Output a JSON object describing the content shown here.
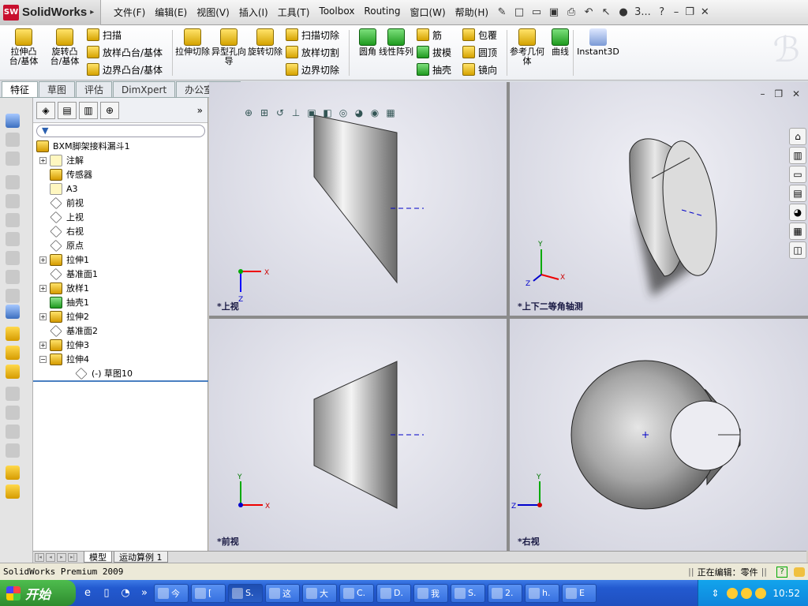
{
  "app": {
    "logo_text": "SolidWorks",
    "logo_badge": "SW"
  },
  "menu": [
    "文件(F)",
    "编辑(E)",
    "视图(V)",
    "插入(I)",
    "工具(T)",
    "Toolbox",
    "Routing",
    "窗口(W)",
    "帮助(H)"
  ],
  "menu_toolbar_tail": "3...",
  "ribbon": {
    "extrude_boss": "拉伸凸台/基体",
    "revolve_boss": "旋转凸台/基体",
    "sweep": "扫描",
    "loft_boss": "放样凸台/基体",
    "boundary_boss": "边界凸台/基体",
    "extrude_cut": "拉伸切除",
    "hole_wizard": "异型孔向导",
    "revolve_cut": "旋转切除",
    "sweep_cut": "扫描切除",
    "loft_cut": "放样切割",
    "boundary_cut": "边界切除",
    "fillet": "圆角",
    "linear_pattern": "线性阵列",
    "rib": "筋",
    "draft": "拔模",
    "shell": "抽壳",
    "wrap": "包覆",
    "dome": "圆顶",
    "mirror": "镜向",
    "ref_geometry": "参考几何体",
    "curves": "曲线",
    "instant3d": "Instant3D"
  },
  "tabs": [
    "特征",
    "草图",
    "评估",
    "DimXpert",
    "办公室产品"
  ],
  "tree": {
    "root": "BXM脚架接料漏斗1",
    "items": [
      {
        "label": "注解",
        "expandable": true,
        "icon": "A"
      },
      {
        "label": "传感器",
        "expandable": false,
        "icon": "sensor"
      },
      {
        "label": "A3",
        "expandable": false,
        "icon": "material"
      },
      {
        "label": "前视",
        "expandable": false,
        "icon": "plane"
      },
      {
        "label": "上视",
        "expandable": false,
        "icon": "plane"
      },
      {
        "label": "右视",
        "expandable": false,
        "icon": "plane"
      },
      {
        "label": "原点",
        "expandable": false,
        "icon": "origin"
      },
      {
        "label": "拉伸1",
        "expandable": true,
        "icon": "feature"
      },
      {
        "label": "基准面1",
        "expandable": false,
        "icon": "plane"
      },
      {
        "label": "放样1",
        "expandable": true,
        "icon": "feature"
      },
      {
        "label": "抽壳1",
        "expandable": false,
        "icon": "shell"
      },
      {
        "label": "拉伸2",
        "expandable": true,
        "icon": "feature"
      },
      {
        "label": "基准面2",
        "expandable": false,
        "icon": "plane"
      },
      {
        "label": "拉伸3",
        "expandable": true,
        "icon": "feature"
      },
      {
        "label": "拉伸4",
        "expandable": true,
        "expanded": true,
        "icon": "feature"
      },
      {
        "label": "(-) 草图10",
        "expandable": false,
        "icon": "sketch",
        "indent": 2
      }
    ]
  },
  "bottom_tabs": [
    "模型",
    "运动算例 1"
  ],
  "views": {
    "top": "*上视",
    "iso": "*上下二等角轴测",
    "front": "*前视",
    "right": "*右视"
  },
  "axes": {
    "x": "X",
    "y": "Y",
    "z": "Z"
  },
  "status": {
    "left": "SolidWorks Premium 2009",
    "editing": "正在编辑：零件",
    "help": "?"
  },
  "taskbar": {
    "start": "开始",
    "tasks": [
      "今",
      "[",
      "S.",
      "这",
      "大",
      "C.",
      "D.",
      "我",
      "S.",
      "2.",
      "h.",
      "E"
    ],
    "clock": "10:52"
  }
}
